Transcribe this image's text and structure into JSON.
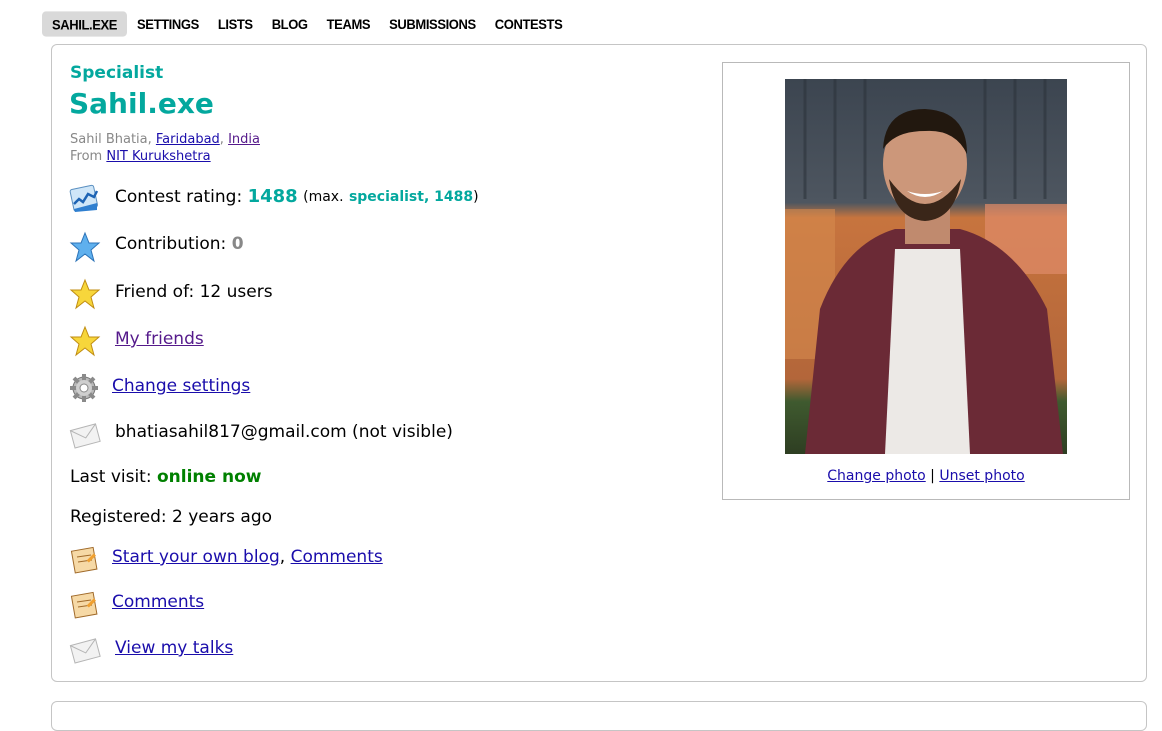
{
  "tabs": [
    "SAHIL.EXE",
    "SETTINGS",
    "LISTS",
    "BLOG",
    "TEAMS",
    "SUBMISSIONS",
    "CONTESTS"
  ],
  "profile": {
    "rank": "Specialist",
    "handle": "Sahil.exe",
    "name": "Sahil Bhatia",
    "city": "Faridabad",
    "country": "India",
    "from_label": "From",
    "organization": "NIT Kurukshetra"
  },
  "stats": {
    "rating_label": "Contest rating:",
    "rating_value": "1488",
    "max_prefix": "(max.",
    "max_value": "specialist, 1488",
    "max_suffix": ")",
    "contribution_label": "Contribution:",
    "contribution_value": "0",
    "friend_of": "Friend of: 12 users",
    "my_friends": "My friends",
    "change_settings": "Change settings",
    "email": "bhatiasahil817@gmail.com (not visible)",
    "last_visit_label": "Last visit:",
    "last_visit_value": "online now",
    "registered": "Registered: 2 years ago",
    "blog_link": "Start your own blog",
    "blog_comments": "Comments",
    "comments": "Comments",
    "talks": "View my talks"
  },
  "photo": {
    "change": "Change photo",
    "separator": "|",
    "unset": "Unset photo"
  },
  "colors": {
    "specialist": "#03a89e",
    "online": "#008000",
    "link": "#1a0dab",
    "visited_link": "#551a8b"
  },
  "icons": [
    "rating-chart-icon",
    "blue-star-icon",
    "gold-star-icon",
    "gold-star-icon",
    "gear-icon",
    "envelope-icon",
    "blog-notepad-icon",
    "blog-notepad-icon",
    "envelope-icon"
  ]
}
